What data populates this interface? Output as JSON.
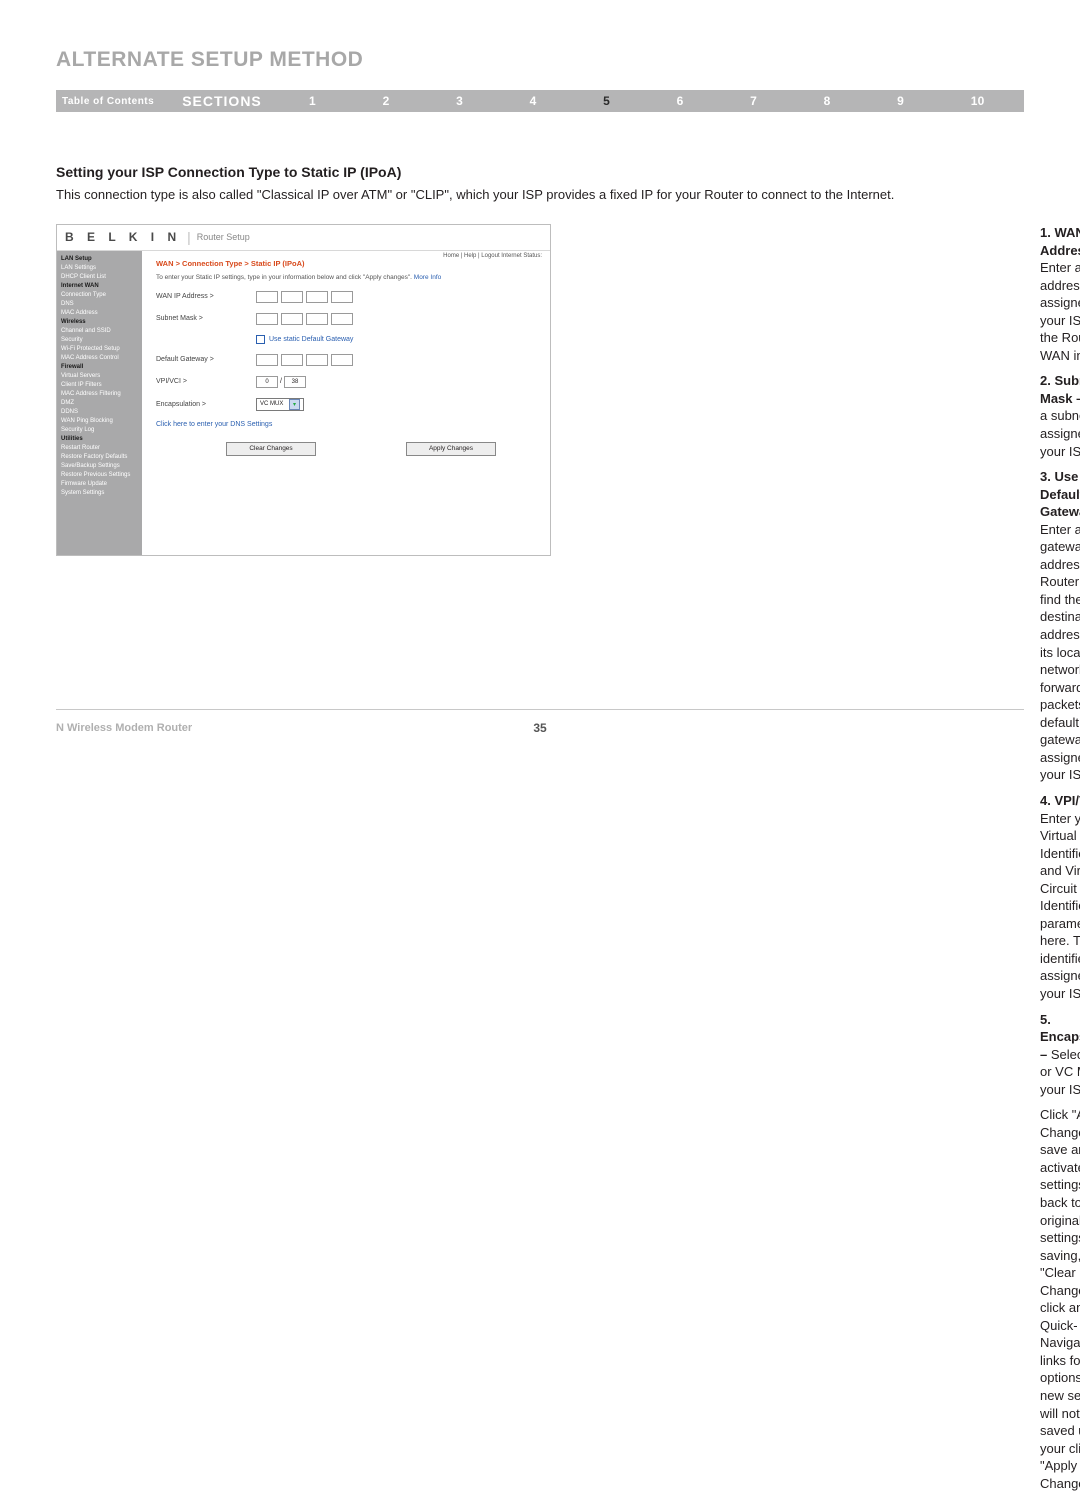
{
  "header": {
    "title": "ALTERNATE SETUP METHOD",
    "toc_label": "Table of Contents",
    "sections_label": "SECTIONS",
    "section_numbers": [
      "1",
      "2",
      "3",
      "4",
      "5",
      "6",
      "7",
      "8",
      "9",
      "10"
    ],
    "current_section": "5"
  },
  "section": {
    "subheading": "Setting your ISP Connection Type to Static IP (IPoA)",
    "intro": "This connection type is also called \"Classical IP over ATM\" or \"CLIP\", which your ISP provides a fixed IP for your Router to connect to the Internet."
  },
  "settings": [
    {
      "num": "1.",
      "label": "WAN IP Address – ",
      "text": "Enter an IP address assigned by your ISP for the Router WAN interface."
    },
    {
      "num": "2.",
      "label": "Subnet Mask – ",
      "text": "Enter a subnet mask assigned by your ISP."
    },
    {
      "num": "3.",
      "label": "Use Static Default Gateway – ",
      "text": "Enter a default gateway IP address. If the Router cannot find the destination address within its local network, it will forward the packets to the default gateway assigned by your ISP."
    },
    {
      "num": "4.",
      "label": "VPI/VCI – ",
      "text": "Enter your Virtual Path Identifier (VPI) and Virtual Circuit Identifier (VCI) parameter here. These identifiers are assigned by your ISP."
    },
    {
      "num": "5.",
      "label": "Encapsulation – ",
      "text": "Select LLC or VC MUX your ISP uses."
    }
  ],
  "final_para": "Click \"Apply Changes\" to save and activate your settings. To go back to the original settings before saving, click \"Clear Changes\". Or click any of the Quick-Navigation links for other options. Your new settings will not be saved unless your click \"Apply Changes\".",
  "router": {
    "brand": "B E L K I N",
    "setup_label": "Router Setup",
    "top_links": "Home | Help | Logout   Internet Status:",
    "sidebar": {
      "groups": [
        {
          "header": "LAN Setup",
          "items": [
            "LAN Settings",
            "DHCP Client List"
          ]
        },
        {
          "header": "Internet WAN",
          "items": [
            "Connection Type",
            "DNS",
            "MAC Address"
          ]
        },
        {
          "header": "Wireless",
          "items": [
            "Channel and SSID",
            "Security",
            "Wi-Fi Protected Setup",
            "MAC Address Control"
          ]
        },
        {
          "header": "Firewall",
          "items": [
            "Virtual Servers",
            "Client IP Filters",
            "MAC Address Filtering",
            "DMZ",
            "DDNS",
            "WAN Ping Blocking",
            "Security Log"
          ]
        },
        {
          "header": "Utilities",
          "items": [
            "Restart Router",
            "Restore Factory Defaults",
            "Save/Backup Settings",
            "Restore Previous Settings",
            "Firmware Update",
            "System Settings"
          ]
        }
      ]
    },
    "breadcrumb": "WAN > Connection Type > Static IP (IPoA)",
    "instruction": "To enter your Static IP settings, type in your information below and click \"Apply changes\".",
    "more_info": "More Info",
    "fields": {
      "wan_ip": "WAN IP Address >",
      "subnet": "Subnet Mask >",
      "use_static_gw": "Use static Default Gateway",
      "default_gw": "Default Gateway >",
      "vpivci": "VPI/VCI >",
      "vpi_val": "0",
      "vpi_sep": "/",
      "vci_val": "38",
      "encaps": "Encapsulation >",
      "encaps_val": "VC MUX"
    },
    "dns_link": "Click here to enter your DNS Settings",
    "buttons": {
      "clear": "Clear Changes",
      "apply": "Apply Changes"
    }
  },
  "footer": {
    "product": "N Wireless Modem Router",
    "page": "35"
  }
}
